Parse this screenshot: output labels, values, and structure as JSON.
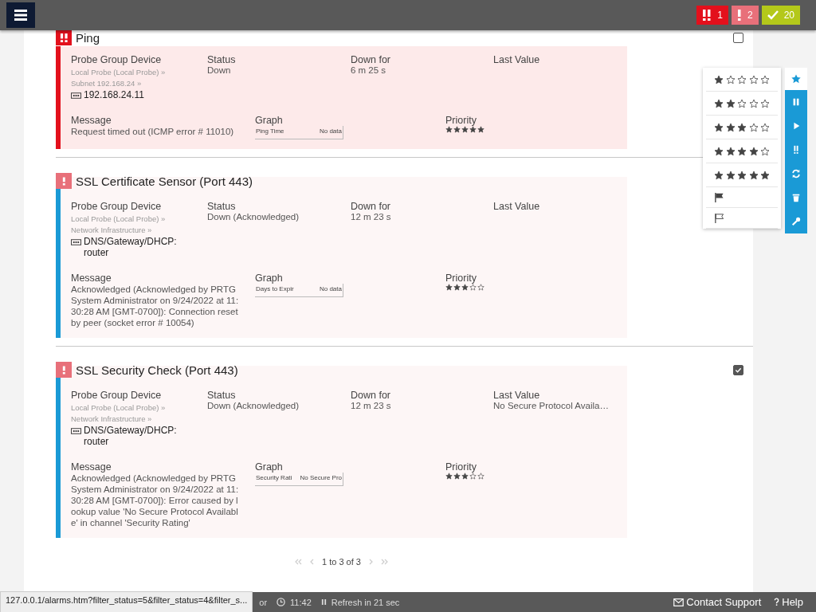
{
  "header": {
    "badges": [
      {
        "kind": "error",
        "count": "1"
      },
      {
        "kind": "warning",
        "count": "2"
      },
      {
        "kind": "ok",
        "count": "20"
      }
    ]
  },
  "alarms": [
    {
      "title": "Ping",
      "kind": "error",
      "acknowledged": false,
      "checked": false,
      "labels": {
        "device": "Probe Group Device",
        "status": "Status",
        "down_for": "Down for",
        "last_value": "Last Value",
        "message": "Message",
        "graph": "Graph",
        "priority": "Priority"
      },
      "path": [
        "Local Probe (Local Probe) »",
        "Subnet 192.168.24 »"
      ],
      "device": "192.168.24.11",
      "status": "Down",
      "down_for": "6 m 25 s",
      "message": "Request timed out (ICMP error # 11010)",
      "graph": {
        "channel": "Ping Time",
        "value": "No data"
      },
      "stars": 5
    },
    {
      "title": "SSL Certificate Sensor (Port 443)",
      "kind": "warning",
      "acknowledged": true,
      "labels": {
        "device": "Probe Group Device",
        "status": "Status",
        "down_for": "Down for",
        "last_value": "Last Value",
        "message": "Message",
        "graph": "Graph",
        "priority": "Priority"
      },
      "path": [
        "Local Probe (Local Probe) »",
        "Network Infrastructure »"
      ],
      "device": "DNS/Gateway/DHCP: router",
      "status": "Down (Acknowledged)",
      "down_for": "12 m 23 s",
      "message": "Acknowledged (Acknowledged by PRTG System Administrator on 9/24/2022 at 11:30:28 AM [GMT-0700]): Connection reset by peer (socket error # 10054)",
      "graph": {
        "channel": "Days to Expir",
        "value": "No data"
      },
      "stars": 3
    },
    {
      "title": "SSL Security Check (Port 443)",
      "kind": "warning",
      "acknowledged": true,
      "checked": true,
      "labels": {
        "device": "Probe Group Device",
        "status": "Status",
        "down_for": "Down for",
        "last_value": "Last Value",
        "message": "Message",
        "graph": "Graph",
        "priority": "Priority"
      },
      "path": [
        "Local Probe (Local Probe) »",
        "Network Infrastructure »"
      ],
      "device": "DNS/Gateway/DHCP: router",
      "status": "Down (Acknowledged)",
      "down_for": "12 m 23 s",
      "last_value": "No Secure Protocol Availa…",
      "message": "Acknowledged (Acknowledged by PRTG System Administrator on 9/24/2022 at 11:30:28 AM [GMT-0700]): Error caused by lookup value 'No Secure Protocol Available' in channel 'Security Rating'",
      "graph": {
        "channel": "Security Rati",
        "value": "No Secure Pro"
      },
      "stars": 3
    }
  ],
  "priority_menu": [
    {
      "kind": "stars",
      "stars": 1
    },
    {
      "kind": "stars",
      "stars": 2
    },
    {
      "kind": "stars",
      "stars": 3
    },
    {
      "kind": "stars",
      "stars": 4
    },
    {
      "kind": "stars",
      "stars": 5
    },
    {
      "kind": "flag"
    },
    {
      "kind": "unflag"
    }
  ],
  "toolbar": [
    {
      "kind": "priority",
      "selected": true
    },
    {
      "kind": "pause",
      "selected": false
    },
    {
      "kind": "resume",
      "selected": false
    },
    {
      "kind": "acknowledge",
      "selected": false
    },
    {
      "kind": "refresh",
      "selected": false
    },
    {
      "kind": "delete",
      "selected": false
    },
    {
      "kind": "settings",
      "selected": false
    }
  ],
  "pagination": {
    "text": "1 to 3 of 3"
  },
  "footer": {
    "url": "127.0.0.1/alarms.htm?filter_status=5&filter_status=4&filter_s...",
    "partial": "or",
    "time": "11:42",
    "refresh": "Refresh in 21 sec",
    "contact": "Contact Support",
    "help": "Help"
  }
}
